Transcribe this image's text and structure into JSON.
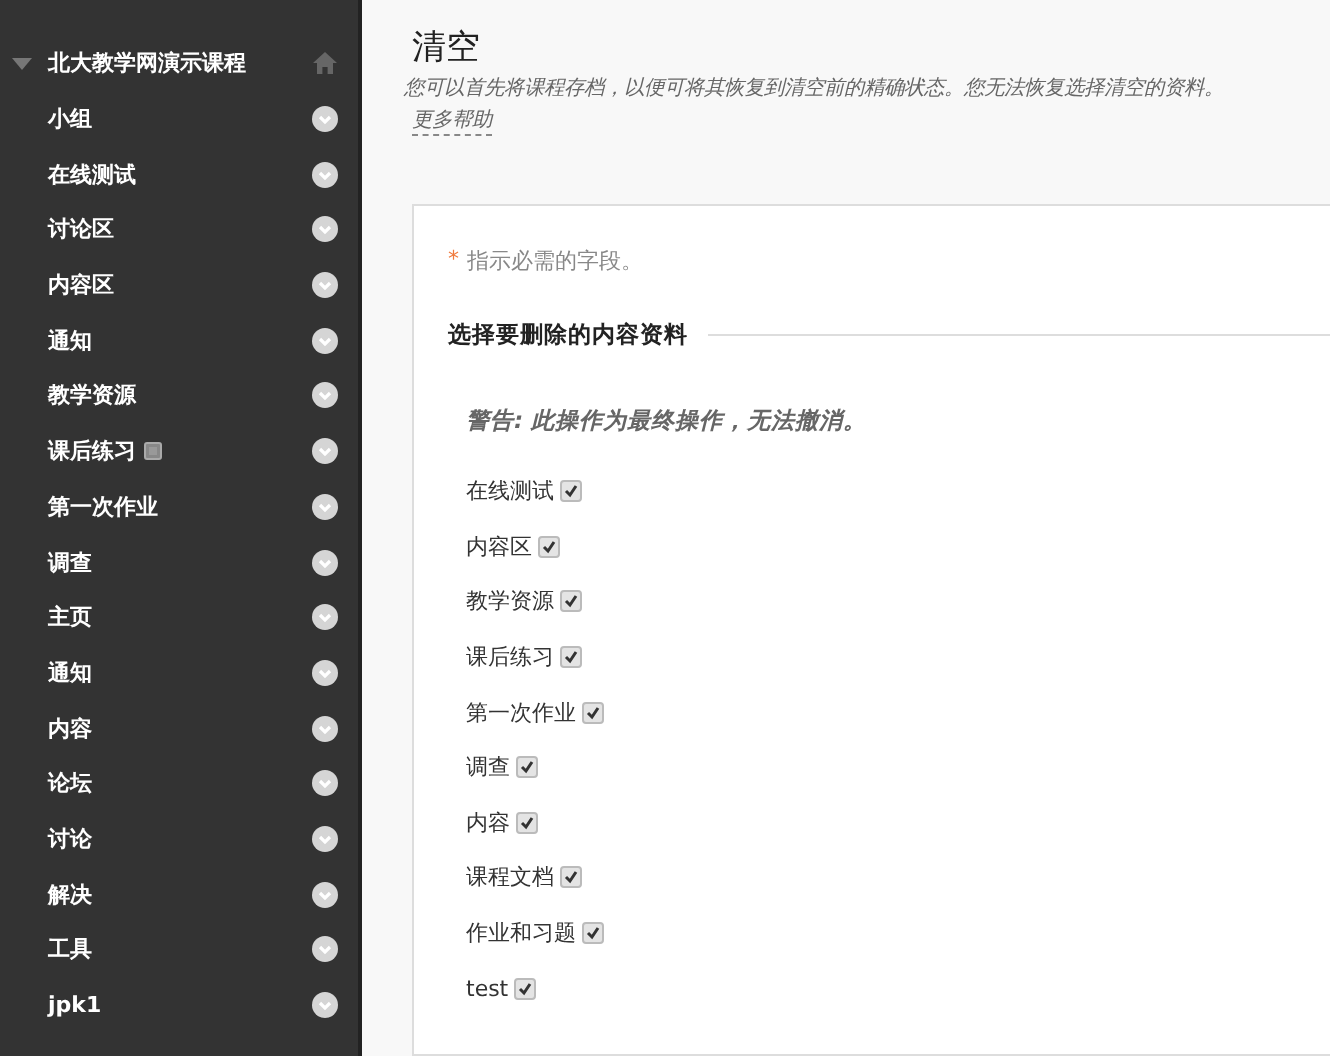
{
  "sidebar": {
    "course": {
      "title": "北大教学网演示课程",
      "expanded": true
    },
    "items": [
      {
        "label": "小组",
        "hidden_mark": false
      },
      {
        "label": "在线测试",
        "hidden_mark": false
      },
      {
        "label": "讨论区",
        "hidden_mark": false
      },
      {
        "label": "内容区",
        "hidden_mark": false
      },
      {
        "label": "通知",
        "hidden_mark": false
      },
      {
        "label": "教学资源",
        "hidden_mark": false
      },
      {
        "label": "课后练习",
        "hidden_mark": true
      },
      {
        "label": "第一次作业",
        "hidden_mark": false
      },
      {
        "label": "调查",
        "hidden_mark": false
      },
      {
        "label": "主页",
        "hidden_mark": false
      },
      {
        "label": "通知",
        "hidden_mark": false
      },
      {
        "label": "内容",
        "hidden_mark": false
      },
      {
        "label": "论坛",
        "hidden_mark": false
      },
      {
        "label": "讨论",
        "hidden_mark": false
      },
      {
        "label": "解决",
        "hidden_mark": false
      },
      {
        "label": "工具",
        "hidden_mark": false
      },
      {
        "label": "jpk1",
        "hidden_mark": false
      }
    ]
  },
  "page": {
    "title": "清空",
    "description": "您可以首先将课程存档，以便可将其恢复到清空前的精确状态。您无法恢复选择清空的资料。",
    "help_link": "更多帮助"
  },
  "form": {
    "required_mark": "*",
    "required_note": "指示必需的字段。",
    "section_title": "选择要删除的内容资料",
    "warning": "警告: 此操作为最终操作，无法撤消。",
    "options": [
      {
        "label": "在线测试",
        "checked": true
      },
      {
        "label": "内容区",
        "checked": true
      },
      {
        "label": "教学资源",
        "checked": true
      },
      {
        "label": "课后练习",
        "checked": true
      },
      {
        "label": "第一次作业",
        "checked": true
      },
      {
        "label": "调查",
        "checked": true
      },
      {
        "label": "内容",
        "checked": true
      },
      {
        "label": "课程文档",
        "checked": true
      },
      {
        "label": "作业和习题",
        "checked": true
      },
      {
        "label": "test",
        "checked": true
      }
    ]
  }
}
